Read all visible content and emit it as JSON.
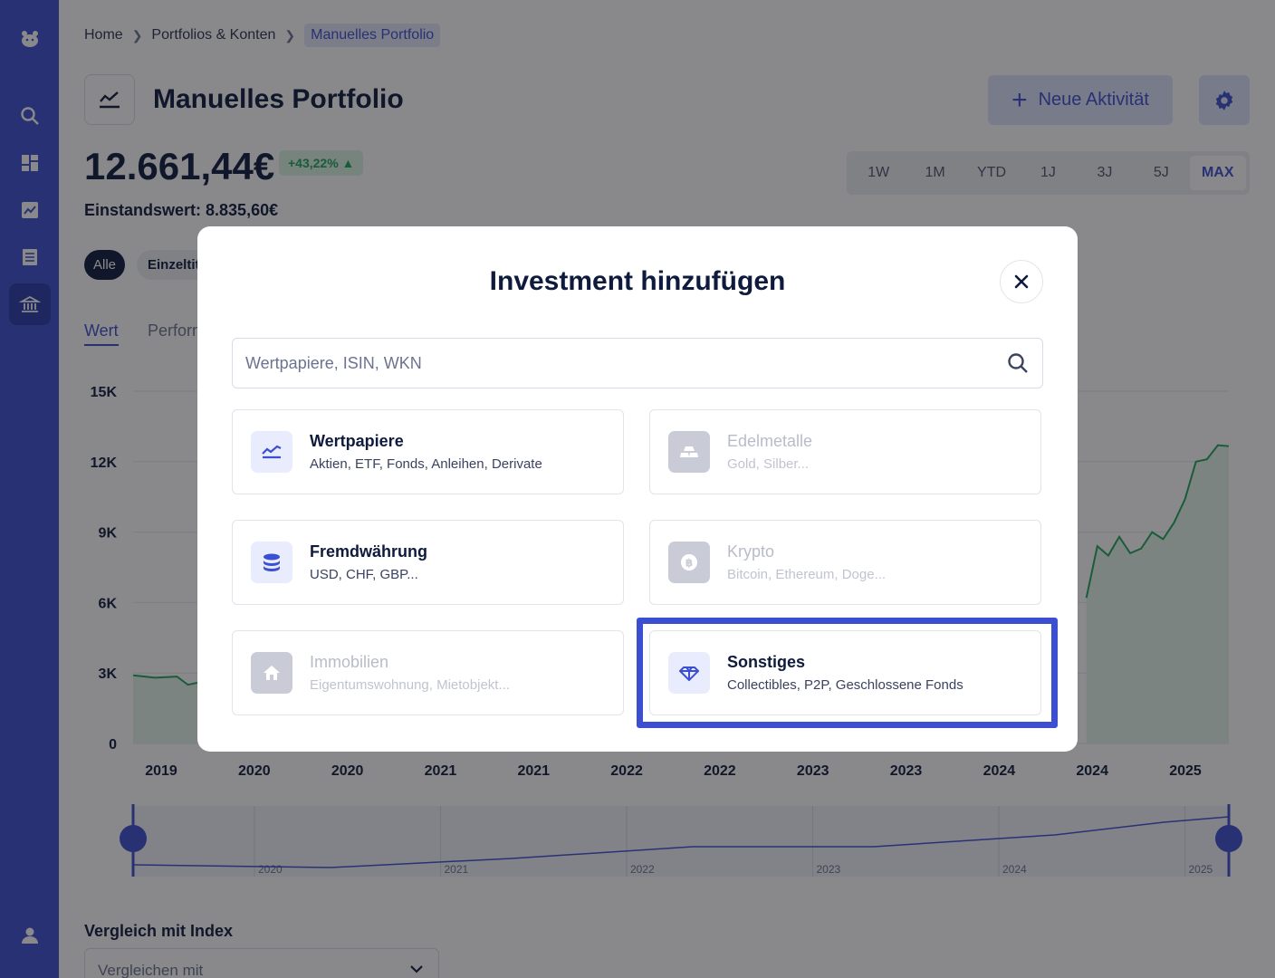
{
  "breadcrumb": {
    "home": "Home",
    "portfolios": "Portfolios & Konten",
    "current": "Manuelles Portfolio"
  },
  "header": {
    "title": "Manuelles Portfolio",
    "new_activity": "Neue Aktivität"
  },
  "summary": {
    "value": "12.661,44€",
    "change": "+43,22% ▲",
    "cost_basis": "Einstandswert: 8.835,60€"
  },
  "ranges": [
    "1W",
    "1M",
    "YTD",
    "1J",
    "3J",
    "5J",
    "MAX"
  ],
  "filters": {
    "all": "Alle",
    "single": "Einzeltitel"
  },
  "tabs": {
    "value": "Wert",
    "performance": "Performance"
  },
  "chart_data": {
    "type": "line",
    "y_ticks": [
      "0",
      "3K",
      "6K",
      "9K",
      "12K",
      "15K"
    ],
    "ylim": [
      0,
      15000
    ],
    "x_ticks": [
      "2019",
      "2020",
      "2020",
      "2021",
      "2021",
      "2022",
      "2022",
      "2023",
      "2023",
      "2024",
      "2024",
      "2025"
    ],
    "series": [
      {
        "points": [
          [
            0.0,
            2900
          ],
          [
            0.02,
            2800
          ],
          [
            0.04,
            2850
          ],
          [
            0.05,
            2500
          ],
          [
            0.06,
            2600
          ],
          [
            0.87,
            6200
          ],
          [
            0.88,
            8400
          ],
          [
            0.89,
            8000
          ],
          [
            0.9,
            8800
          ],
          [
            0.91,
            8100
          ],
          [
            0.92,
            8300
          ],
          [
            0.93,
            9000
          ],
          [
            0.94,
            8700
          ],
          [
            0.95,
            9400
          ],
          [
            0.96,
            10400
          ],
          [
            0.97,
            12000
          ],
          [
            0.98,
            12100
          ],
          [
            0.99,
            12700
          ],
          [
            1.0,
            12660
          ]
        ]
      }
    ],
    "navigator_labels": [
      "2020",
      "2021",
      "2022",
      "2023",
      "2024",
      "2025"
    ]
  },
  "compare": {
    "label": "Vergleich mit Index",
    "placeholder": "Vergleichen mit"
  },
  "modal": {
    "title": "Investment hinzufügen",
    "search_placeholder": "Wertpapiere, ISIN, WKN",
    "cards": [
      {
        "title": "Wertpapiere",
        "subtitle": "Aktien, ETF, Fonds, Anleihen, Derivate",
        "icon": "chart-line-icon",
        "enabled": true
      },
      {
        "title": "Edelmetalle",
        "subtitle": "Gold, Silber...",
        "icon": "gold-bars-icon",
        "enabled": false
      },
      {
        "title": "Fremdwährung",
        "subtitle": "USD, CHF, GBP...",
        "icon": "coins-stack-icon",
        "enabled": true
      },
      {
        "title": "Krypto",
        "subtitle": "Bitcoin, Ethereum, Doge...",
        "icon": "bitcoin-icon",
        "enabled": false
      },
      {
        "title": "Immobilien",
        "subtitle": "Eigentumswohnung, Mietobjekt...",
        "icon": "house-icon",
        "enabled": false
      },
      {
        "title": "Sonstiges",
        "subtitle": "Collectibles, P2P, Geschlossene Fonds",
        "icon": "diamond-icon",
        "enabled": true
      }
    ]
  },
  "colors": {
    "brand": "#3c4fd1",
    "positive": "#1fa55a",
    "overlay": "rgba(20,20,24,0.5)",
    "highlight": "#3c4fd1"
  }
}
